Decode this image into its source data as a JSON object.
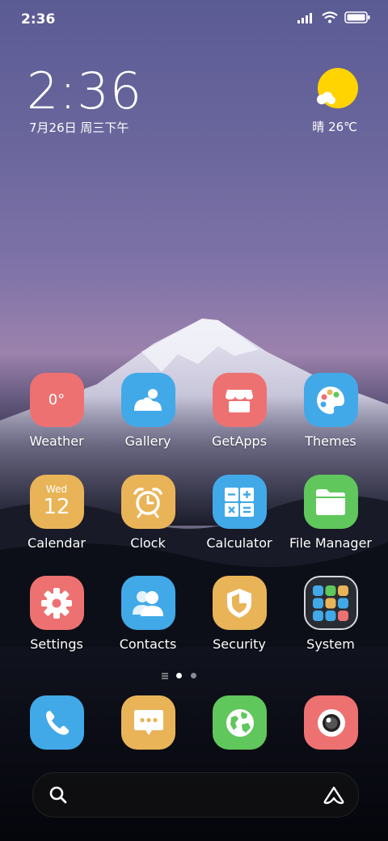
{
  "status_bar": {
    "time": "2:36",
    "icons": [
      "signal-icon",
      "wifi-icon",
      "battery-icon"
    ]
  },
  "widget": {
    "time": "2:36",
    "date": "7月26日 周三下午",
    "weather": "晴 26℃"
  },
  "apps": [
    {
      "label": "Weather",
      "icon": "weather-icon",
      "color": "#ee7171",
      "text": "0°"
    },
    {
      "label": "Gallery",
      "icon": "gallery-icon",
      "color": "#42a9e8"
    },
    {
      "label": "GetApps",
      "icon": "store-icon",
      "color": "#ee7171"
    },
    {
      "label": "Themes",
      "icon": "palette-icon",
      "color": "#42a9e8"
    },
    {
      "label": "Calendar",
      "icon": "calendar-icon",
      "color": "#e9b458",
      "day": "Wed",
      "date": "12"
    },
    {
      "label": "Clock",
      "icon": "alarm-clock-icon",
      "color": "#e9b458"
    },
    {
      "label": "Calculator",
      "icon": "calculator-icon",
      "color": "#42a9e8"
    },
    {
      "label": "File Manager",
      "icon": "folder-icon",
      "color": "#5fc75b"
    },
    {
      "label": "Settings",
      "icon": "gear-icon",
      "color": "#ee7171"
    },
    {
      "label": "Contacts",
      "icon": "contacts-icon",
      "color": "#42a9e8"
    },
    {
      "label": "Security",
      "icon": "shield-icon",
      "color": "#e9b458"
    },
    {
      "label": "System",
      "icon": "folder-grid-icon",
      "color": "#2a2c34"
    }
  ],
  "page_indicator": {
    "pages": 2,
    "current": 1
  },
  "dock": [
    {
      "name": "phone",
      "icon": "phone-icon",
      "color": "#42a9e8"
    },
    {
      "name": "messages",
      "icon": "message-icon",
      "color": "#e9b458"
    },
    {
      "name": "browser",
      "icon": "globe-icon",
      "color": "#5fc75b"
    },
    {
      "name": "camera",
      "icon": "camera-icon",
      "color": "#ee7171"
    }
  ],
  "search": {
    "icons": [
      "search-icon",
      "assistant-icon"
    ]
  }
}
